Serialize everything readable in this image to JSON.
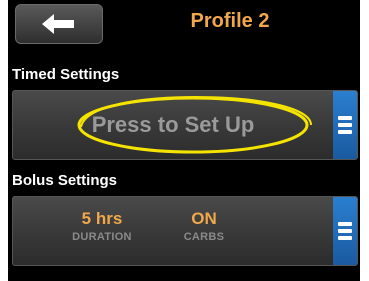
{
  "header": {
    "title": "Profile 2",
    "back_icon": "arrow-left-icon"
  },
  "timed_settings": {
    "label": "Timed Settings",
    "prompt": "Press to Set Up",
    "menu_icon": "menu-icon",
    "highlight_color": "#f5e400"
  },
  "bolus_settings": {
    "label": "Bolus Settings",
    "duration": {
      "value": "5 hrs",
      "label": "DURATION"
    },
    "carbs": {
      "value": "ON",
      "label": "CARBS"
    },
    "menu_icon": "menu-icon"
  },
  "colors": {
    "accent": "#f0a84a",
    "menu_blue": "#1f6dbd",
    "background": "#000000"
  }
}
